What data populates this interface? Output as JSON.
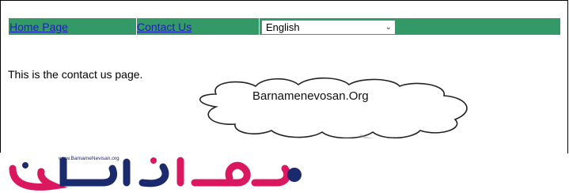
{
  "nav": {
    "home_label": "Home Page",
    "contact_label": "Contact Us",
    "language_selected": "English"
  },
  "content": {
    "text": "This is the contact us page."
  },
  "watermark": {
    "cloud_text": "Barnamenevosan.Org",
    "logo_small_text": "www.BarnameNevisan.org"
  },
  "colors": {
    "nav_bg": "#339966",
    "link": "#1f1fb8",
    "logo_blue": "#1a2a6c",
    "logo_pink": "#d9185f"
  }
}
